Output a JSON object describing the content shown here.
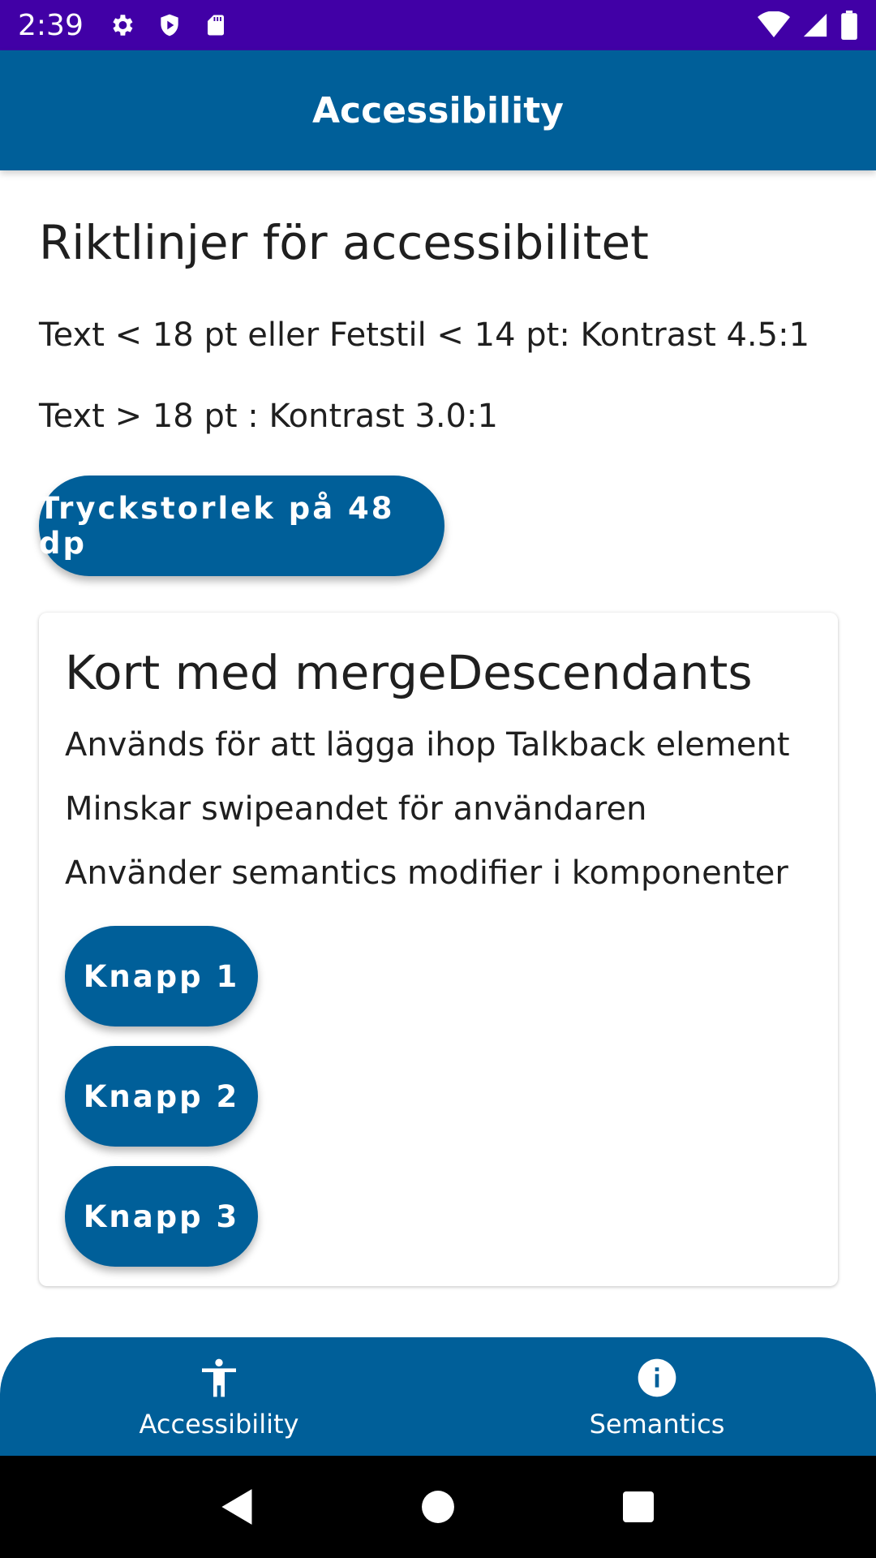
{
  "status_bar": {
    "time": "2:39",
    "icons_left": [
      "settings-icon",
      "shield-play-icon",
      "sd-card-icon"
    ],
    "icons_right": [
      "wifi-icon",
      "signal-icon",
      "battery-icon"
    ]
  },
  "app_bar": {
    "title": "Accessibility"
  },
  "main": {
    "heading": "Riktlinjer för accessibilitet",
    "rule_1": "Text < 18 pt eller Fetstil < 14 pt: Kontrast 4.5:1",
    "rule_2": "Text > 18 pt : Kontrast 3.0:1",
    "touch_button_label": "Tryckstorlek på 48 dp"
  },
  "card": {
    "title": "Kort med mergeDescendants",
    "lines": [
      "Används för att lägga ihop Talkback element",
      "Minskar swipeandet för användaren",
      "Använder semantics modifier i komponenter"
    ],
    "buttons": [
      "Knapp 1",
      "Knapp 2",
      "Knapp 3"
    ]
  },
  "bottom_nav": {
    "items": [
      {
        "label": "Accessibility",
        "icon": "accessibility-icon"
      },
      {
        "label": "Semantics",
        "icon": "info-icon"
      }
    ]
  },
  "system_nav": {
    "buttons": [
      "back-icon",
      "home-icon",
      "recents-icon"
    ]
  },
  "colors": {
    "status_bar": "#4100A6",
    "primary": "#005F99",
    "on_primary": "#FFFFFF",
    "text": "#1F1F1F"
  }
}
